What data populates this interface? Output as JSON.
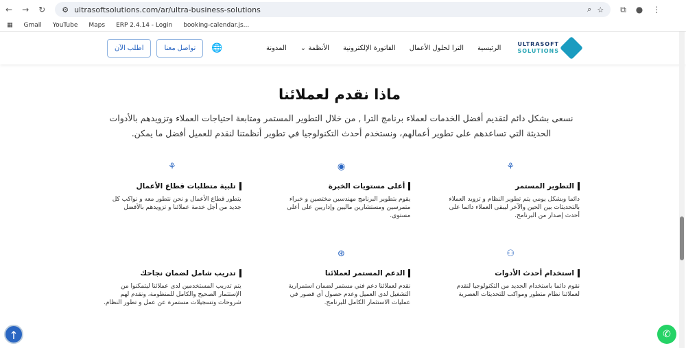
{
  "browser": {
    "url": "ultrasoftsolutions.com/ar/ultra-business-solutions",
    "bookmarks": [
      "Gmail",
      "YouTube",
      "Maps",
      "ERP 2.4.14 - Login",
      "booking-calendar.js..."
    ]
  },
  "header": {
    "logo_top": "ULTRASOFT",
    "logo_bottom": "SOLUTIONS",
    "nav": [
      "الرئيسية",
      "الترا لحلول الأعمال",
      "الفاتورة الإلكترونية",
      "الأنظمة ⌄",
      "المدونة"
    ],
    "contact": "تواصل معنا",
    "order": "اطلب الآن"
  },
  "section": {
    "title": "ماذا نقدم لعملائنا",
    "lead": "نسعى بشكل دائم لتقديم أفضل الخدمات لعملاء برنامج الترا , من خلال التطوير المستمر ومتابعة احتياجات العملاء وتزويدهم بالأدوات الحديثة التي تساعدهم على تطوير أعمالهم، ونستخدم أحدث التكنولوجيا في تطوير أنظمتنا لنقدم للعميل أفضل ما يمكن."
  },
  "cards": [
    {
      "title": "التطوير المستمر",
      "text": "دائما وبشكل يومي يتم تطوير النظام و تزويد العملاء بالتحديثات بين الحين والآخر ليبقى العملاء دائما على أحدث إصدار من البرنامج."
    },
    {
      "title": "أعلى مستويات الخبرة",
      "text": "يقوم بتطوير البرنامج مهندسين مختصين و خبراء متمرسين ومستشارين ماليين وإداريين على أعلى مستوى."
    },
    {
      "title": "تلبية متطلبات قطاع الأعمال",
      "text": "يتطور قطاع الأعمال و نحن نتطور معه و نواكب كل جديد من أجل خدمة عملائنا و تزويدهم بالأفضل"
    },
    {
      "title": "استخدام أحدث الأدوات",
      "text": "نقوم دائما باستخدام الجديد من التكنولوجيا لنقدم لعملائنا نظام متطور ومواكب للتحديثات العصرية"
    },
    {
      "title": "الدعم المستمر لعملائنا",
      "text": "نقدم لعملائنا دعم فني مستمر لضمان استمرارية التشغيل لدى العميل وعدم حصول أي قصور في عمليات الاستثمار الكامل للبرنامج."
    },
    {
      "title": "تدريب شامل لضمان نجاحك",
      "text": "يتم تدريب المستخدمين لدى عملائنا ليتمكنوا من الإستثمار الصحيح والكامل للمنظومة، ونقدم لهم شروحات وتسجيلات مستمرة عن عمل و تطور النظام."
    }
  ]
}
